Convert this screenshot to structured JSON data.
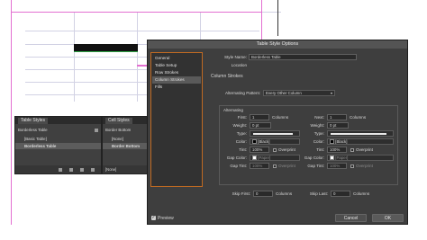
{
  "panels": {
    "table_styles": {
      "tab_label": "Table Styles",
      "current_style": "Borderless Table",
      "items": [
        "[Basic Table]",
        "Borderless Table"
      ]
    },
    "cell_styles": {
      "tab_label": "Cell Styles",
      "current_style": "Border Bottom",
      "items": [
        "[None]",
        "Border Bottom"
      ],
      "footer_item": "[None]"
    }
  },
  "dialog": {
    "title": "Table Style Options",
    "categories": [
      "General",
      "Table Setup",
      "Row Strokes",
      "Column Strokes",
      "Fills"
    ],
    "selected_category": "Column Strokes",
    "style_name_label": "Style Name:",
    "style_name_value": "Borderless Table",
    "location_label": "Location",
    "section_title": "Column Strokes",
    "alternating_pattern_label": "Alternating Pattern:",
    "alternating_pattern_value": "Every Other Column",
    "alternating_group_label": "Alternating",
    "first": {
      "label": "First:",
      "value": "1",
      "unit": "Columns"
    },
    "next": {
      "label": "Next:",
      "value": "1",
      "unit": "Columns"
    },
    "weight_left": {
      "label": "Weight:",
      "value": "0 pt"
    },
    "weight_right": {
      "label": "Weight:",
      "value": "0 pt"
    },
    "type_left": {
      "label": "Type:"
    },
    "type_right": {
      "label": "Type:"
    },
    "color_left": {
      "label": "Color:",
      "value": "[Black]"
    },
    "color_right": {
      "label": "Color:",
      "value": "[Black]"
    },
    "tint_left": {
      "label": "Tint:",
      "value": "100%",
      "overprint": "Overprint"
    },
    "tint_right": {
      "label": "Tint:",
      "value": "100%",
      "overprint": "Overprint"
    },
    "gap_color_left": {
      "label": "Gap Color:",
      "value": "[Paper]"
    },
    "gap_color_right": {
      "label": "Gap Color:",
      "value": "[Paper]"
    },
    "gap_tint_left": {
      "label": "Gap Tint:",
      "value": "100%",
      "overprint": "Overprint"
    },
    "gap_tint_right": {
      "label": "Gap Tint:",
      "value": "100%",
      "overprint": "Overprint"
    },
    "skip_first": {
      "label": "Skip First:",
      "value": "0",
      "unit": "Columns"
    },
    "skip_last": {
      "label": "Skip Last:",
      "value": "0",
      "unit": "Columns"
    },
    "preview_label": "Preview",
    "cancel_label": "Cancel",
    "ok_label": "OK"
  },
  "colors": {
    "guide_pink": "#e36fd1",
    "panel_bg": "#404040",
    "dialog_bg": "#3e3e3e",
    "category_border": "#c06a22"
  }
}
